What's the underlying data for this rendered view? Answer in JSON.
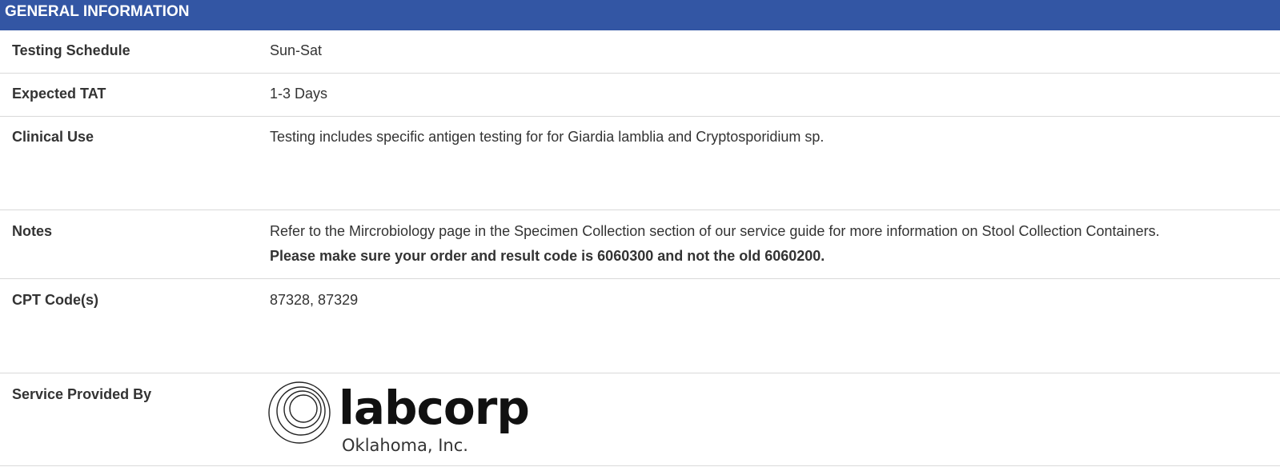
{
  "header": {
    "title": "GENERAL INFORMATION"
  },
  "rows": [
    {
      "label": "Testing Schedule",
      "value": "Sun-Sat"
    },
    {
      "label": "Expected TAT",
      "value": "1-3 Days"
    },
    {
      "label": "Clinical Use",
      "value": "Testing includes specific antigen testing for for Giardia lamblia and Cryptosporidium sp."
    },
    {
      "label": "Notes",
      "value": "Refer to the Mircrobiology page in the Specimen Collection section of our service guide for more information on Stool Collection Containers.",
      "value_bold": "Please make sure your order and result code is 6060300 and not the old 6060200."
    },
    {
      "label": "CPT Code(s)",
      "value": "87328, 87329"
    },
    {
      "label": "Service Provided By",
      "logo_name": "labcorp",
      "logo_sub": "Oklahoma, Inc."
    }
  ],
  "colors": {
    "header_bg": "#3356a4",
    "header_text": "#ffffff",
    "text": "#333333",
    "divider": "#d9d9d9"
  }
}
